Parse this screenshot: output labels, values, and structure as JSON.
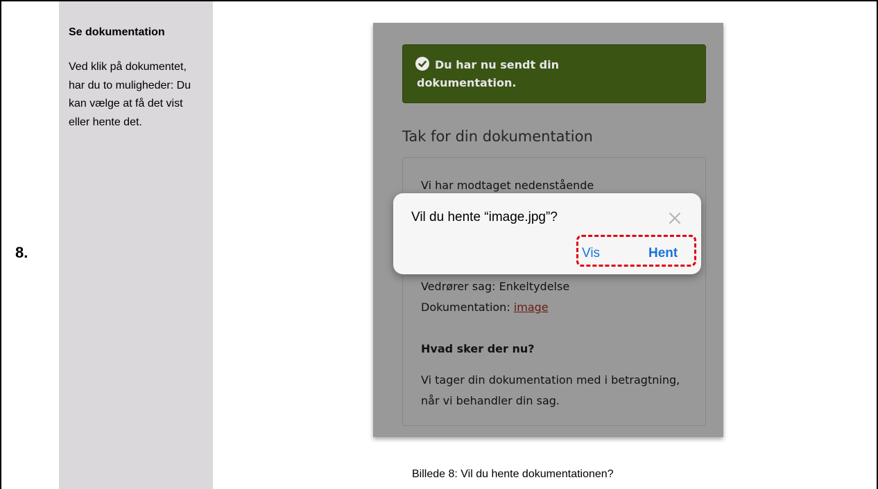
{
  "step": {
    "number": "8."
  },
  "left_panel": {
    "heading": "Se dokumentation",
    "body": "Ved klik på dokumentet, har du to muligheder: Du kan vælge at få det vist eller hente det."
  },
  "screenshot": {
    "success_alert": "Du har nu sendt din dokumentation.",
    "thanks_title": "Tak for din dokumentation",
    "card": {
      "received_text": "Vi har modtaget nedenstående",
      "case_line": "Vedrører sag: Enkeltydelse",
      "doc_label": "Dokumentation: ",
      "doc_link": "image",
      "what_next": "Hvad sker der nu?",
      "info": "Vi tager din dokumentation med i betragtning, når vi behandler din sag."
    },
    "dialog": {
      "question": "Vil du hente “image.jpg”?",
      "view_label": "Vis",
      "download_label": "Hent"
    }
  },
  "caption": "Billede 8: Vil du hente dokumentationen?",
  "colors": {
    "success_bg": "#3a5414",
    "overlay_gray": "#999999",
    "link_blue": "#1a73d9",
    "highlight_red": "#e0000e",
    "side_panel": "#dad8da"
  }
}
